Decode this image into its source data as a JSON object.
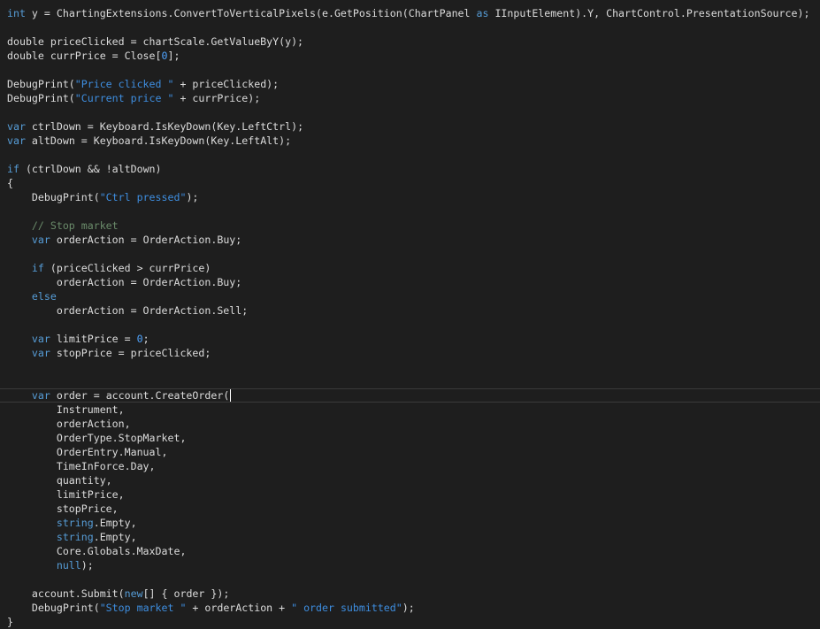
{
  "editor": {
    "current_line_index": 27,
    "caret_after_line_index": 27,
    "colors": {
      "background": "#1e1e1e",
      "text": "#dcdcdc",
      "keyword": "#569cd6",
      "string": "#3e8ee0",
      "number": "#4fa4ff",
      "comment": "#6a8b6a"
    },
    "lines": [
      [
        {
          "t": "kw",
          "v": "int"
        },
        {
          "t": "id",
          "v": " y = ChartingExtensions.ConvertToVerticalPixels(e.GetPosition(ChartPanel "
        },
        {
          "t": "kw",
          "v": "as"
        },
        {
          "t": "id",
          "v": " IInputElement).Y, ChartControl.PresentationSource);"
        }
      ],
      [],
      [
        {
          "t": "id",
          "v": "double priceClicked = chartScale.GetValueByY(y);"
        }
      ],
      [
        {
          "t": "id",
          "v": "double currPrice = Close["
        },
        {
          "t": "num",
          "v": "0"
        },
        {
          "t": "id",
          "v": "];"
        }
      ],
      [],
      [
        {
          "t": "id",
          "v": "DebugPrint("
        },
        {
          "t": "str",
          "v": "\"Price clicked \""
        },
        {
          "t": "id",
          "v": " + priceClicked);"
        }
      ],
      [
        {
          "t": "id",
          "v": "DebugPrint("
        },
        {
          "t": "str",
          "v": "\"Current price \""
        },
        {
          "t": "id",
          "v": " + currPrice);"
        }
      ],
      [],
      [
        {
          "t": "kw",
          "v": "var"
        },
        {
          "t": "id",
          "v": " ctrlDown = Keyboard.IsKeyDown(Key.LeftCtrl);"
        }
      ],
      [
        {
          "t": "kw",
          "v": "var"
        },
        {
          "t": "id",
          "v": " altDown = Keyboard.IsKeyDown(Key.LeftAlt);"
        }
      ],
      [],
      [
        {
          "t": "kw",
          "v": "if"
        },
        {
          "t": "id",
          "v": " (ctrlDown && !altDown)"
        }
      ],
      [
        {
          "t": "id",
          "v": "{"
        }
      ],
      [
        {
          "t": "id",
          "v": "    DebugPrint("
        },
        {
          "t": "str",
          "v": "\"Ctrl pressed\""
        },
        {
          "t": "id",
          "v": ");"
        }
      ],
      [],
      [
        {
          "t": "id",
          "v": "    "
        },
        {
          "t": "com",
          "v": "// Stop market"
        }
      ],
      [
        {
          "t": "id",
          "v": "    "
        },
        {
          "t": "kw",
          "v": "var"
        },
        {
          "t": "id",
          "v": " orderAction = OrderAction.Buy;"
        }
      ],
      [],
      [
        {
          "t": "id",
          "v": "    "
        },
        {
          "t": "kw",
          "v": "if"
        },
        {
          "t": "id",
          "v": " (priceClicked > currPrice)"
        }
      ],
      [
        {
          "t": "id",
          "v": "        orderAction = OrderAction.Buy;"
        }
      ],
      [
        {
          "t": "id",
          "v": "    "
        },
        {
          "t": "kw",
          "v": "else"
        }
      ],
      [
        {
          "t": "id",
          "v": "        orderAction = OrderAction.Sell;"
        }
      ],
      [],
      [
        {
          "t": "id",
          "v": "    "
        },
        {
          "t": "kw",
          "v": "var"
        },
        {
          "t": "id",
          "v": " limitPrice = "
        },
        {
          "t": "num",
          "v": "0"
        },
        {
          "t": "id",
          "v": ";"
        }
      ],
      [
        {
          "t": "id",
          "v": "    "
        },
        {
          "t": "kw",
          "v": "var"
        },
        {
          "t": "id",
          "v": " stopPrice = priceClicked;"
        }
      ],
      [],
      [],
      [
        {
          "t": "id",
          "v": "    "
        },
        {
          "t": "kw",
          "v": "var"
        },
        {
          "t": "id",
          "v": " order = account.CreateOrder("
        }
      ],
      [
        {
          "t": "id",
          "v": "        Instrument,"
        }
      ],
      [
        {
          "t": "id",
          "v": "        orderAction,"
        }
      ],
      [
        {
          "t": "id",
          "v": "        OrderType.StopMarket,"
        }
      ],
      [
        {
          "t": "id",
          "v": "        OrderEntry.Manual,"
        }
      ],
      [
        {
          "t": "id",
          "v": "        TimeInForce.Day,"
        }
      ],
      [
        {
          "t": "id",
          "v": "        quantity,"
        }
      ],
      [
        {
          "t": "id",
          "v": "        limitPrice,"
        }
      ],
      [
        {
          "t": "id",
          "v": "        stopPrice,"
        }
      ],
      [
        {
          "t": "id",
          "v": "        "
        },
        {
          "t": "kw",
          "v": "string"
        },
        {
          "t": "id",
          "v": ".Empty,"
        }
      ],
      [
        {
          "t": "id",
          "v": "        "
        },
        {
          "t": "kw",
          "v": "string"
        },
        {
          "t": "id",
          "v": ".Empty,"
        }
      ],
      [
        {
          "t": "id",
          "v": "        Core.Globals.MaxDate,"
        }
      ],
      [
        {
          "t": "id",
          "v": "        "
        },
        {
          "t": "kw",
          "v": "null"
        },
        {
          "t": "id",
          "v": ");"
        }
      ],
      [],
      [
        {
          "t": "id",
          "v": "    account.Submit("
        },
        {
          "t": "kw",
          "v": "new"
        },
        {
          "t": "id",
          "v": "[] { order });"
        }
      ],
      [
        {
          "t": "id",
          "v": "    DebugPrint("
        },
        {
          "t": "str",
          "v": "\"Stop market \""
        },
        {
          "t": "id",
          "v": " + orderAction + "
        },
        {
          "t": "str",
          "v": "\" order submitted\""
        },
        {
          "t": "id",
          "v": ");"
        }
      ],
      [
        {
          "t": "id",
          "v": "}"
        }
      ]
    ]
  }
}
